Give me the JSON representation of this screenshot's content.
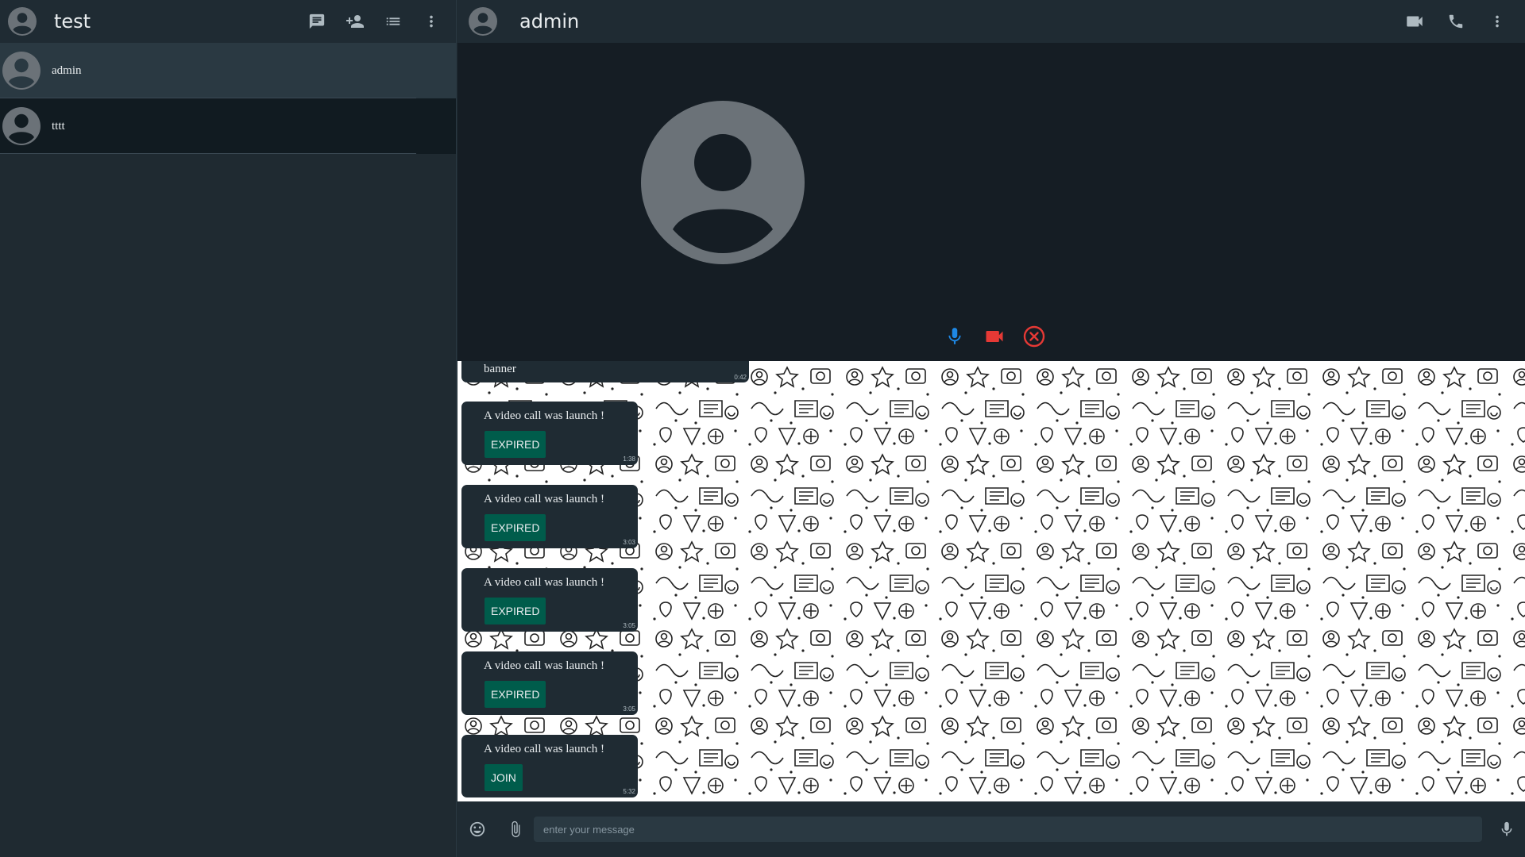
{
  "left": {
    "title": "test",
    "contacts": [
      {
        "name": "admin"
      },
      {
        "name": "tttt"
      }
    ]
  },
  "right": {
    "title": "admin"
  },
  "messages": {
    "banner": {
      "text": "banner",
      "time": "0:42"
    },
    "calls": [
      {
        "text": "A video call was launch !",
        "button": "EXPIRED",
        "time": "1:38"
      },
      {
        "text": "A video call was launch !",
        "button": "EXPIRED",
        "time": "3:03"
      },
      {
        "text": "A video call was launch !",
        "button": "EXPIRED",
        "time": "3:05"
      },
      {
        "text": "A video call was launch !",
        "button": "EXPIRED",
        "time": "3:05"
      },
      {
        "text": "A video call was launch !",
        "button": "JOIN",
        "time": "5:32"
      }
    ]
  },
  "composer": {
    "placeholder": "enter your message"
  },
  "colors": {
    "panel": "#1f2b33",
    "accent_button": "#005c4b",
    "mic_active": "#1e88e5",
    "video_active": "#e53935",
    "hangup": "#e53935"
  }
}
